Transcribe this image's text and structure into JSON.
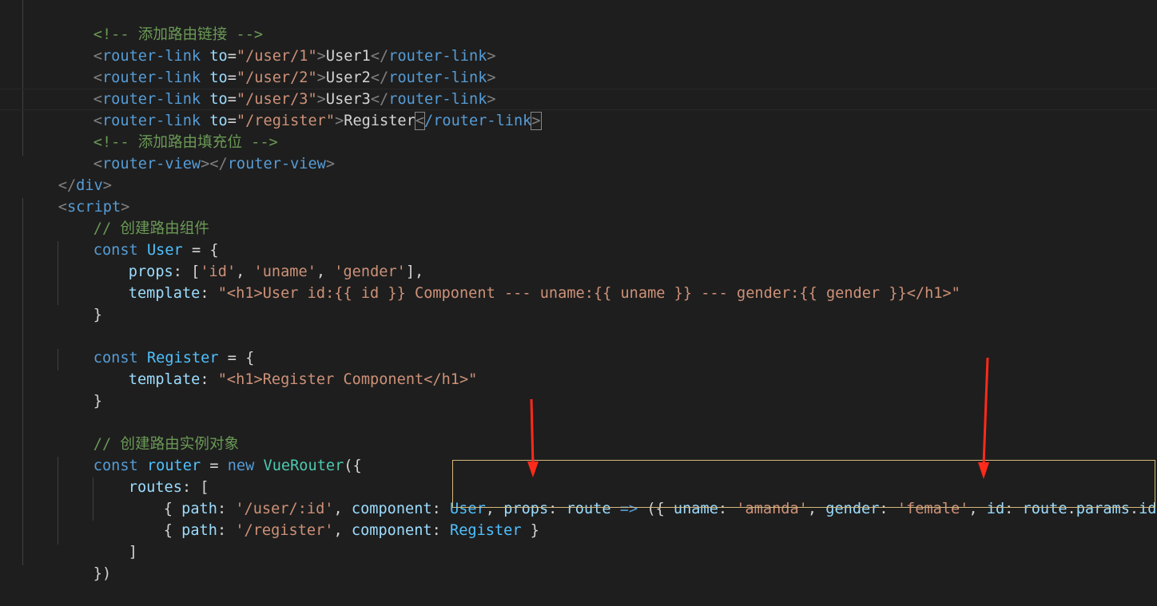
{
  "colors": {
    "background": "#1e1e1e",
    "comment": "#6a9955",
    "tag": "#569cd6",
    "punct": "#808080",
    "attr": "#9cdcfe",
    "string": "#ce9178",
    "text": "#d4d4d4",
    "keyword": "#569cd6",
    "variable": "#4fc1ff",
    "class": "#4ec9b0",
    "annotation_box": "#d7ba7d",
    "annotation_arrow": "#ff2a1a"
  },
  "code": {
    "line1": [
      "<!-- ",
      "添加路由链接",
      " -->"
    ],
    "line2": [
      "<",
      "router-link",
      " ",
      "to",
      "=",
      "\"/user/1\"",
      ">",
      "User1",
      "</",
      "router-link",
      ">"
    ],
    "line3": [
      "<",
      "router-link",
      " ",
      "to",
      "=",
      "\"/user/2\"",
      ">",
      "User2",
      "</",
      "router-link",
      ">"
    ],
    "line4": [
      "<",
      "router-link",
      " ",
      "to",
      "=",
      "\"/user/3\"",
      ">",
      "User3",
      "</",
      "router-link",
      ">"
    ],
    "line5": [
      "<",
      "router-link",
      " ",
      "to",
      "=",
      "\"/register\"",
      ">",
      "Register",
      "<",
      "/router-link",
      ">"
    ],
    "line6": [
      "<!-- ",
      "添加路由填充位",
      " -->"
    ],
    "line7": [
      "<",
      "router-view",
      "></",
      "router-view",
      ">"
    ],
    "line8": [
      "</",
      "div",
      ">"
    ],
    "line9": [
      "<",
      "script",
      ">"
    ],
    "line10": [
      "// ",
      "创建路由组件"
    ],
    "line11": [
      "const",
      " ",
      "User",
      " = {"
    ],
    "line12": [
      "props",
      ": [",
      "'id'",
      ", ",
      "'uname'",
      ", ",
      "'gender'",
      "],"
    ],
    "line13": [
      "template",
      ": ",
      "\"<h1>User id:{{ id }} Component --- uname:{{ uname }} --- gender:{{ gender }}</h1>\""
    ],
    "line14": [
      "}"
    ],
    "line16": [
      "const",
      " ",
      "Register",
      " = {"
    ],
    "line17": [
      "template",
      ": ",
      "\"<h1>Register Component</h1>\""
    ],
    "line18": [
      "}"
    ],
    "line20": [
      "// ",
      "创建路由实例对象"
    ],
    "line21": [
      "const",
      " ",
      "router",
      " = ",
      "new",
      " ",
      "VueRouter",
      "({"
    ],
    "line22": [
      "routes",
      ": ["
    ],
    "line23": [
      "{ ",
      "path",
      ": ",
      "'/user/:id'",
      ", ",
      "component",
      ": ",
      "User",
      ", ",
      "props",
      ": ",
      "route",
      " => ",
      "({ ",
      "uname",
      ": ",
      "'amanda'",
      ", ",
      "gender",
      ": ",
      "'female'",
      ", ",
      "id",
      ": ",
      "route",
      ".",
      "params",
      ".",
      "id",
      " }) },"
    ],
    "line24": [
      "{ ",
      "path",
      ": ",
      "'/register'",
      ", ",
      "component",
      ": ",
      "Register",
      " }"
    ],
    "line25": [
      "]"
    ],
    "line26": [
      "})"
    ]
  }
}
